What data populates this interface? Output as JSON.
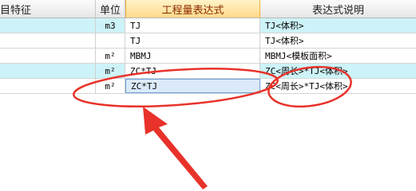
{
  "headers": {
    "feature": "目特征",
    "unit": "单位",
    "expression": "工程量表达式",
    "description": "表达式说明"
  },
  "rows": [
    {
      "unit": "m3",
      "expr": "TJ",
      "desc": "TJ<体积>"
    },
    {
      "unit": "",
      "expr": "TJ",
      "desc": "TJ<体积>"
    },
    {
      "unit": "m²",
      "expr": "MBMJ",
      "desc": "MBMJ<模板面积>"
    },
    {
      "unit": "m²",
      "expr": "ZC*TJ",
      "desc": "ZC<周长>*TJ<体积>"
    },
    {
      "unit": "m²",
      "expr": "ZC*TJ",
      "desc": "ZC<周长>*TJ<体积>"
    }
  ],
  "colors": {
    "annotation_red": "#e8322a",
    "row_highlight": "#cdf3f8",
    "header_active": "#ffd98a"
  }
}
